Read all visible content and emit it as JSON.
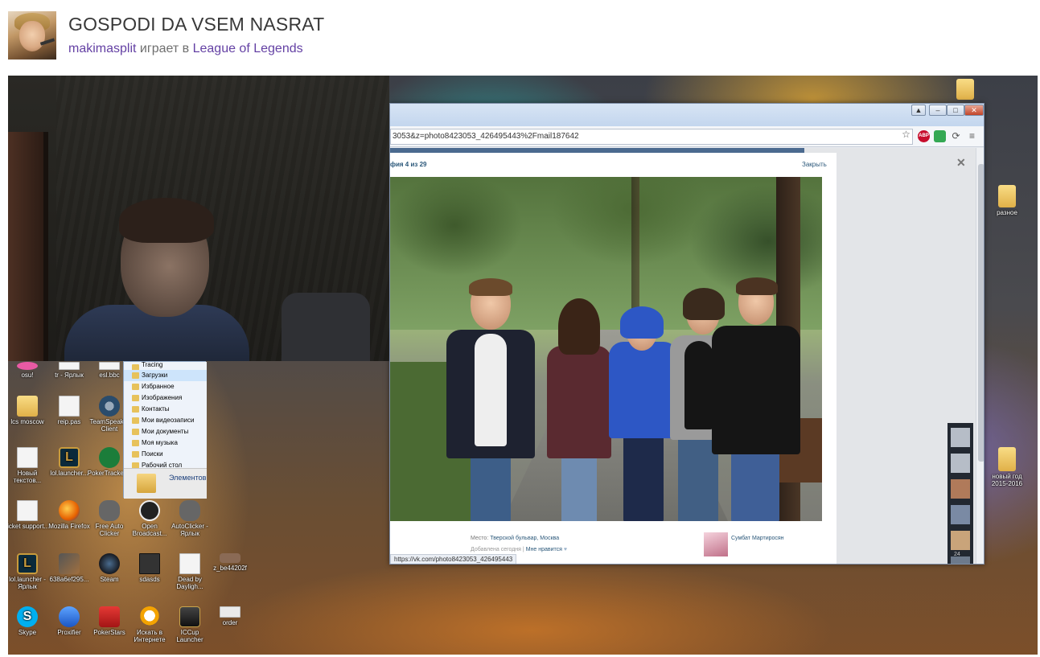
{
  "channel": {
    "title": "GOSPODI DA VSEM NASRAT",
    "streamer": "makimasplit",
    "playing_word": "играет в",
    "game": "League of Legends"
  },
  "browser": {
    "url": "3053&z=photo8423053_426495443%2Fmail187642",
    "status_url": "https://vk.com/photo8423053_426495443",
    "photo_counter": "фия 4 из 29",
    "close_link": "Закрыть",
    "place_label": "Место:",
    "place_value": "Тверской бульвар, Москва",
    "added_label": "Добавлена сегодня",
    "like_label": "Мне нравится",
    "commenter": "Сумбат Мартиросян",
    "friends_count": "24",
    "abp_label": "ABP"
  },
  "explorer": {
    "items": [
      "Tracing",
      "Загрузки",
      "Избранное",
      "Изображения",
      "Контакты",
      "Мои видеозаписи",
      "Мои документы",
      "Моя музыка",
      "Поиски",
      "Рабочий стол"
    ],
    "selected_index": 1,
    "big_label": "Элементов"
  },
  "desktop_icons": {
    "row1": [
      "osu!",
      "tr - Ярлык",
      "esl.bbc"
    ],
    "row2": [
      "lcs moscow",
      "reip.pas",
      "TeamSpeak 3 Client"
    ],
    "row3": [
      "Новый текстов...",
      "lol.launcher...",
      "PokerTracker 4"
    ],
    "row4": [
      "ticket support...",
      "Mozilla Firefox",
      "Free Auto Clicker",
      "Open Broadcast...",
      "AutoClicker - Ярлык"
    ],
    "row5": [
      "lol.launcher - Ярлык",
      "638a6ef295...",
      "Steam",
      "sdasds",
      "Dead by Dayligh...",
      "z_be44202f"
    ],
    "row6": [
      "Skype",
      "Proxifier",
      "PokerStars",
      "Искать в Интернете",
      "ICCup Launcher",
      "order"
    ],
    "right": [
      "разное",
      "новый год 2015-2016"
    ]
  },
  "colors": {
    "link_purple": "#6441a4",
    "title_text": "#383838",
    "vk_blue": "#2b587a"
  }
}
